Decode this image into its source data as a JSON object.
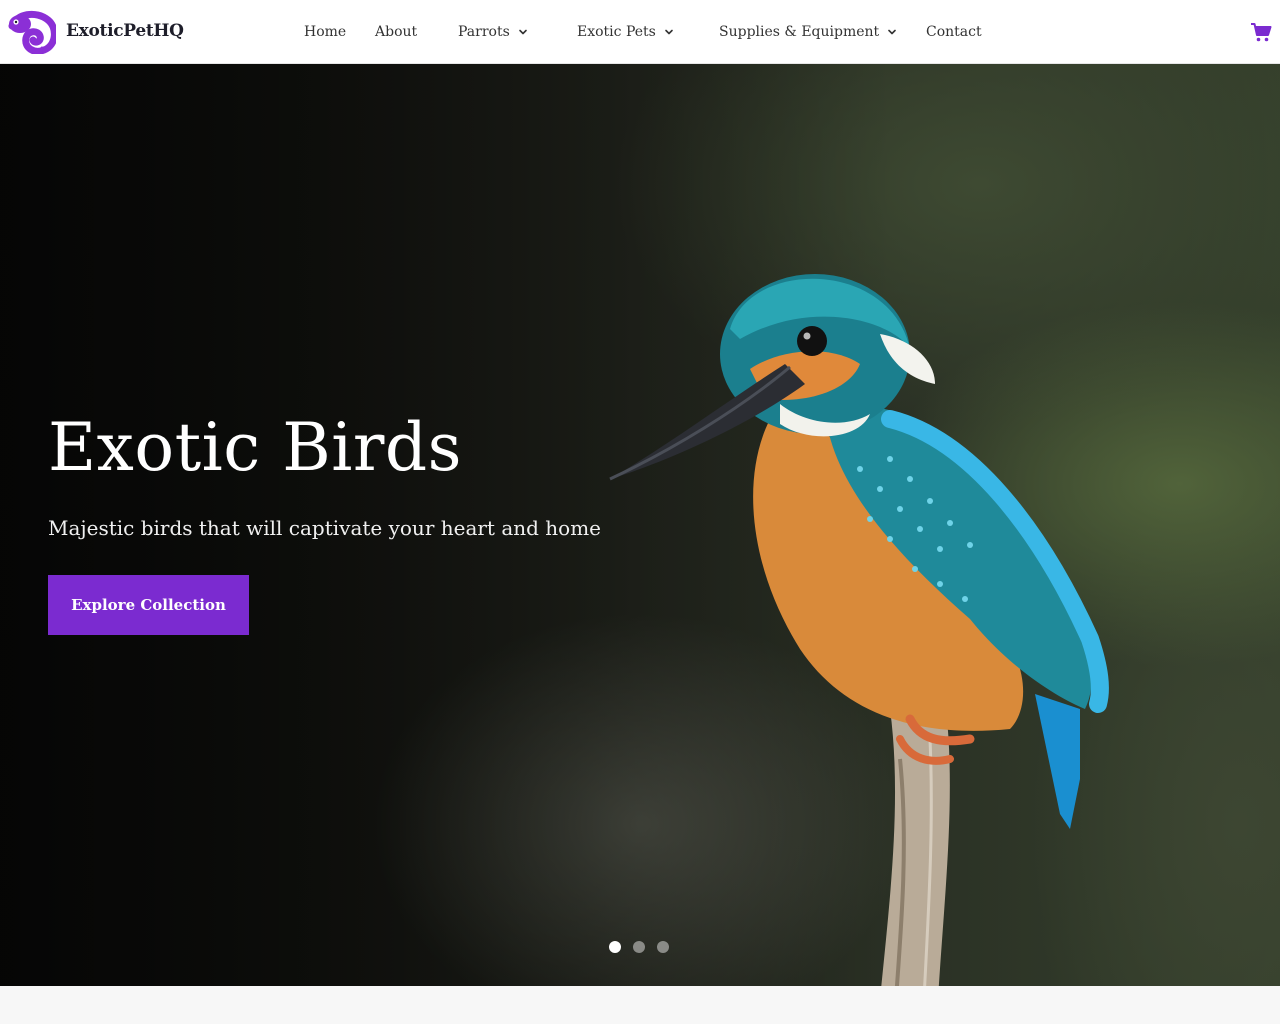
{
  "brand": {
    "name": "ExoticPetHQ",
    "logo_icon": "chameleon-icon",
    "accent_color": "#7b2bd0"
  },
  "nav": {
    "items": [
      {
        "label": "Home",
        "has_dropdown": false
      },
      {
        "label": "About",
        "has_dropdown": false
      },
      {
        "label": "Parrots",
        "has_dropdown": true
      },
      {
        "label": "Exotic Pets",
        "has_dropdown": true
      },
      {
        "label": "Supplies & Equipment",
        "has_dropdown": true
      },
      {
        "label": "Contact",
        "has_dropdown": false
      }
    ],
    "cart_icon": "shopping-cart-icon"
  },
  "hero": {
    "title": "Exotic Birds",
    "subtitle": "Majestic birds that will captivate your heart and home",
    "cta_label": "Explore Collection",
    "image": "kingfisher-on-branch",
    "slides_count": 3,
    "active_slide": 1
  }
}
